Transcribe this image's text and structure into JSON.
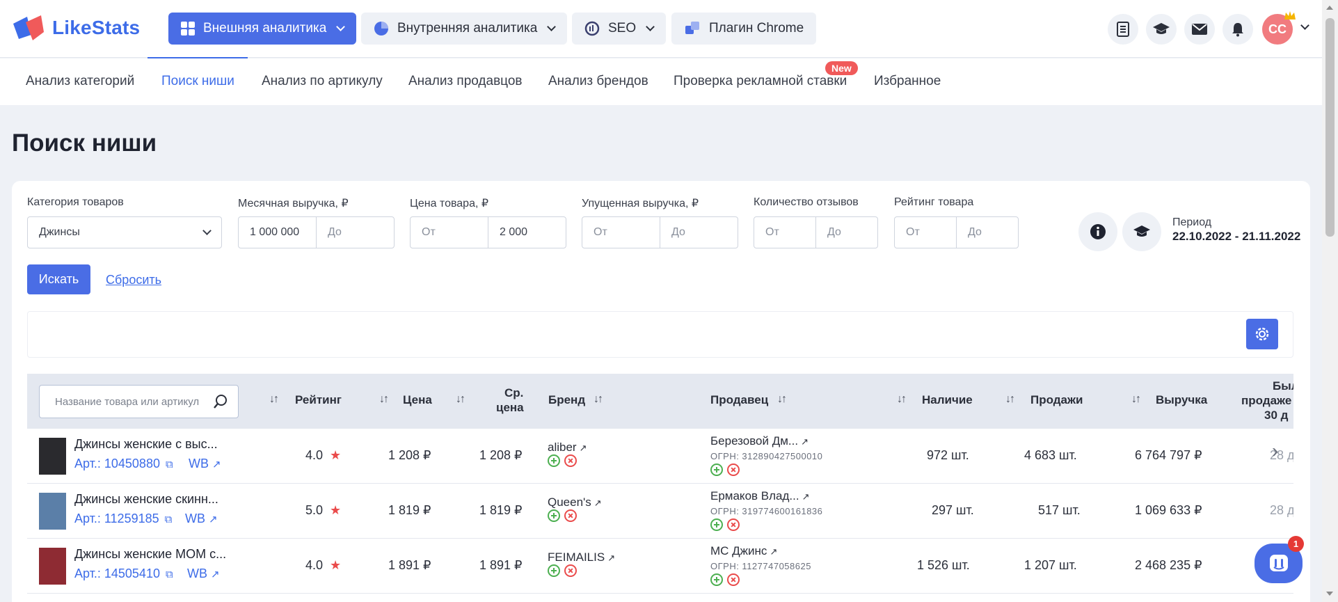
{
  "app": {
    "name": "LikeStats"
  },
  "topnav": {
    "items": [
      {
        "label": "Внешняя аналитика",
        "icon": "grid-icon"
      },
      {
        "label": "Внутренняя аналитика",
        "icon": "pie-chart-icon"
      },
      {
        "label": "SEO",
        "icon": "seo-icon"
      },
      {
        "label": "Плагин Chrome",
        "icon": "puzzle-icon"
      }
    ],
    "user_initials": "CC"
  },
  "subnav": {
    "items": [
      "Анализ категорий",
      "Поиск ниши",
      "Анализ по артикулу",
      "Анализ продавцов",
      "Анализ брендов",
      "Проверка рекламной ставки",
      "Избранное"
    ],
    "active_index": 1,
    "new_badge": "New"
  },
  "page": {
    "title": "Поиск ниши"
  },
  "filters": {
    "category": {
      "label": "Категория товаров",
      "value": "Джинсы"
    },
    "revenue": {
      "label": "Месячная выручка, ₽",
      "from": "1 000 000",
      "to_placeholder": "До"
    },
    "price": {
      "label": "Цена товара, ₽",
      "from_placeholder": "От",
      "to": "2 000"
    },
    "lost_revenue": {
      "label": "Упущенная выручка, ₽",
      "from_placeholder": "От",
      "to_placeholder": "До"
    },
    "reviews": {
      "label": "Количество отзывов",
      "from_placeholder": "От",
      "to_placeholder": "До"
    },
    "rating": {
      "label": "Рейтинг товара",
      "from_placeholder": "От",
      "to_placeholder": "До"
    },
    "period": {
      "label": "Период",
      "value": "22.10.2022 - 21.11.2022"
    },
    "search_button": "Искать",
    "reset_link": "Сбросить"
  },
  "table": {
    "search_placeholder": "Название товара или артикул",
    "headers": {
      "rating": "Рейтинг",
      "price": "Цена",
      "avg_price_1": "Ср.",
      "avg_price_2": "цена",
      "brand": "Бренд",
      "seller": "Продавец",
      "stock": "Наличие",
      "sales": "Продажи",
      "revenue": "Выручка",
      "days_1": "Был",
      "days_2": "продаже",
      "days_3": "30 д"
    },
    "rows": [
      {
        "name": "Джинсы женские с выс...",
        "article": "Арт.: 10450880",
        "wb": "WB",
        "rating": "4.0",
        "price": "1 208 ₽",
        "avg_price": "1 208 ₽",
        "brand": "aliber",
        "seller": "Березовой Дм...",
        "ogrn": "ОГРН: 312890427500010",
        "stock": "972 шт.",
        "sales": "4 683 шт.",
        "revenue": "6 764 797 ₽",
        "days": "28 д"
      },
      {
        "name": "Джинсы женские скинн...",
        "article": "Арт.: 11259185",
        "wb": "WB",
        "rating": "5.0",
        "price": "1 819 ₽",
        "avg_price": "1 819 ₽",
        "brand": "Queen's",
        "seller": "Ермаков Влад...",
        "ogrn": "ОГРН: 319774600161836",
        "stock": "297 шт.",
        "sales": "517 шт.",
        "revenue": "1 069 633 ₽",
        "days": "28 д"
      },
      {
        "name": "Джинсы женские MOM с...",
        "article": "Арт.: 14505410",
        "wb": "WB",
        "rating": "4.0",
        "price": "1 891 ₽",
        "avg_price": "1 891 ₽",
        "brand": "FEIMAILIS",
        "seller": "МС Джинс",
        "ogrn": "ОГРН: 1127747058625",
        "stock": "1 526 шт.",
        "sales": "1 207 шт.",
        "revenue": "2 468 235 ₽",
        "days": ""
      }
    ]
  },
  "chat": {
    "badge_count": "1"
  },
  "colors": {
    "accent": "#4a6de5",
    "link": "#3d6ce8",
    "star": "#ea4b4b",
    "add": "#4caf50",
    "remove": "#ea4b4b"
  }
}
